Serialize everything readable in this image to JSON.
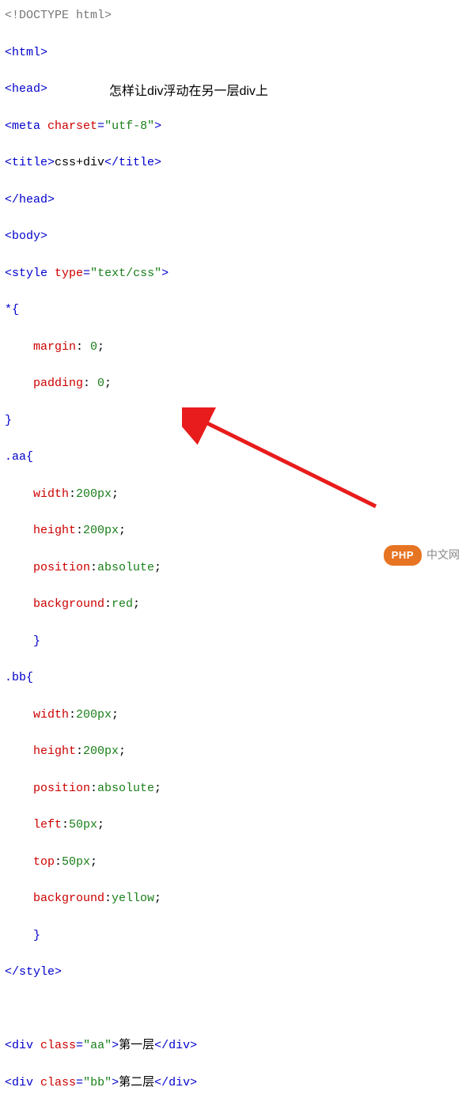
{
  "overlay": {
    "annotation_text": "怎样让div浮动在另一层div上"
  },
  "badge": {
    "pill": "PHP",
    "label": "中文网"
  },
  "code": {
    "l1_gray": "<!DOCTYPE html>",
    "l2_tag": "<html>",
    "l3_tag": "<head>",
    "l4_open": "<",
    "l4_tagname": "meta ",
    "l4_attr": "charset",
    "l4_eq": "=",
    "l4_val": "\"utf-8\"",
    "l4_close": ">",
    "l5_open": "<title>",
    "l5_text": "css+div",
    "l5_close": "</title>",
    "l6": "</head>",
    "l7": "<body>",
    "l8_open": "<",
    "l8_tag": "style ",
    "l8_attr": "type",
    "l8_eq": "=",
    "l8_val": "\"text/css\"",
    "l8_close": ">",
    "l9": "*{",
    "l10_prop": "margin",
    "l10_colon": ": ",
    "l10_val": "0",
    "l10_semi": ";",
    "l11_prop": "padding",
    "l11_colon": ": ",
    "l11_val": "0",
    "l11_semi": ";",
    "l12": "}",
    "l13": ".aa{",
    "l14_prop": "width",
    "l14_colon": ":",
    "l14_val": "200px",
    "l14_semi": ";",
    "l15_prop": "height",
    "l15_colon": ":",
    "l15_val": "200px",
    "l15_semi": ";",
    "l16_prop": "position",
    "l16_colon": ":",
    "l16_val": "absolute",
    "l16_semi": ";",
    "l17_prop": "background",
    "l17_colon": ":",
    "l17_val": "red",
    "l17_semi": ";",
    "l18": "}",
    "l19": ".bb{",
    "l20_prop": "width",
    "l20_colon": ":",
    "l20_val": "200px",
    "l20_semi": ";",
    "l21_prop": "height",
    "l21_colon": ":",
    "l21_val": "200px",
    "l21_semi": ";",
    "l22_prop": "position",
    "l22_colon": ":",
    "l22_val": "absolute",
    "l22_semi": ";",
    "l23_prop": "left",
    "l23_colon": ":",
    "l23_val": "50px",
    "l23_semi": ";",
    "l24_prop": "top",
    "l24_colon": ":",
    "l24_val": "50px",
    "l24_semi": ";",
    "l25_prop": "background",
    "l25_colon": ":",
    "l25_val": "yellow",
    "l25_semi": ";",
    "l26": "}",
    "l27": "</style>",
    "blank": " ",
    "l29_open": "<",
    "l29_tag": "div ",
    "l29_attr": "class",
    "l29_eq": "=",
    "l29_val": "\"aa\"",
    "l29_close": ">",
    "l29_text": "第一层",
    "l29_end": "</div>",
    "l30_open": "<",
    "l30_tag": "div ",
    "l30_attr": "class",
    "l30_eq": "=",
    "l30_val": "\"bb\"",
    "l30_close": ">",
    "l30_text": "第二层",
    "l30_end": "</div>"
  }
}
